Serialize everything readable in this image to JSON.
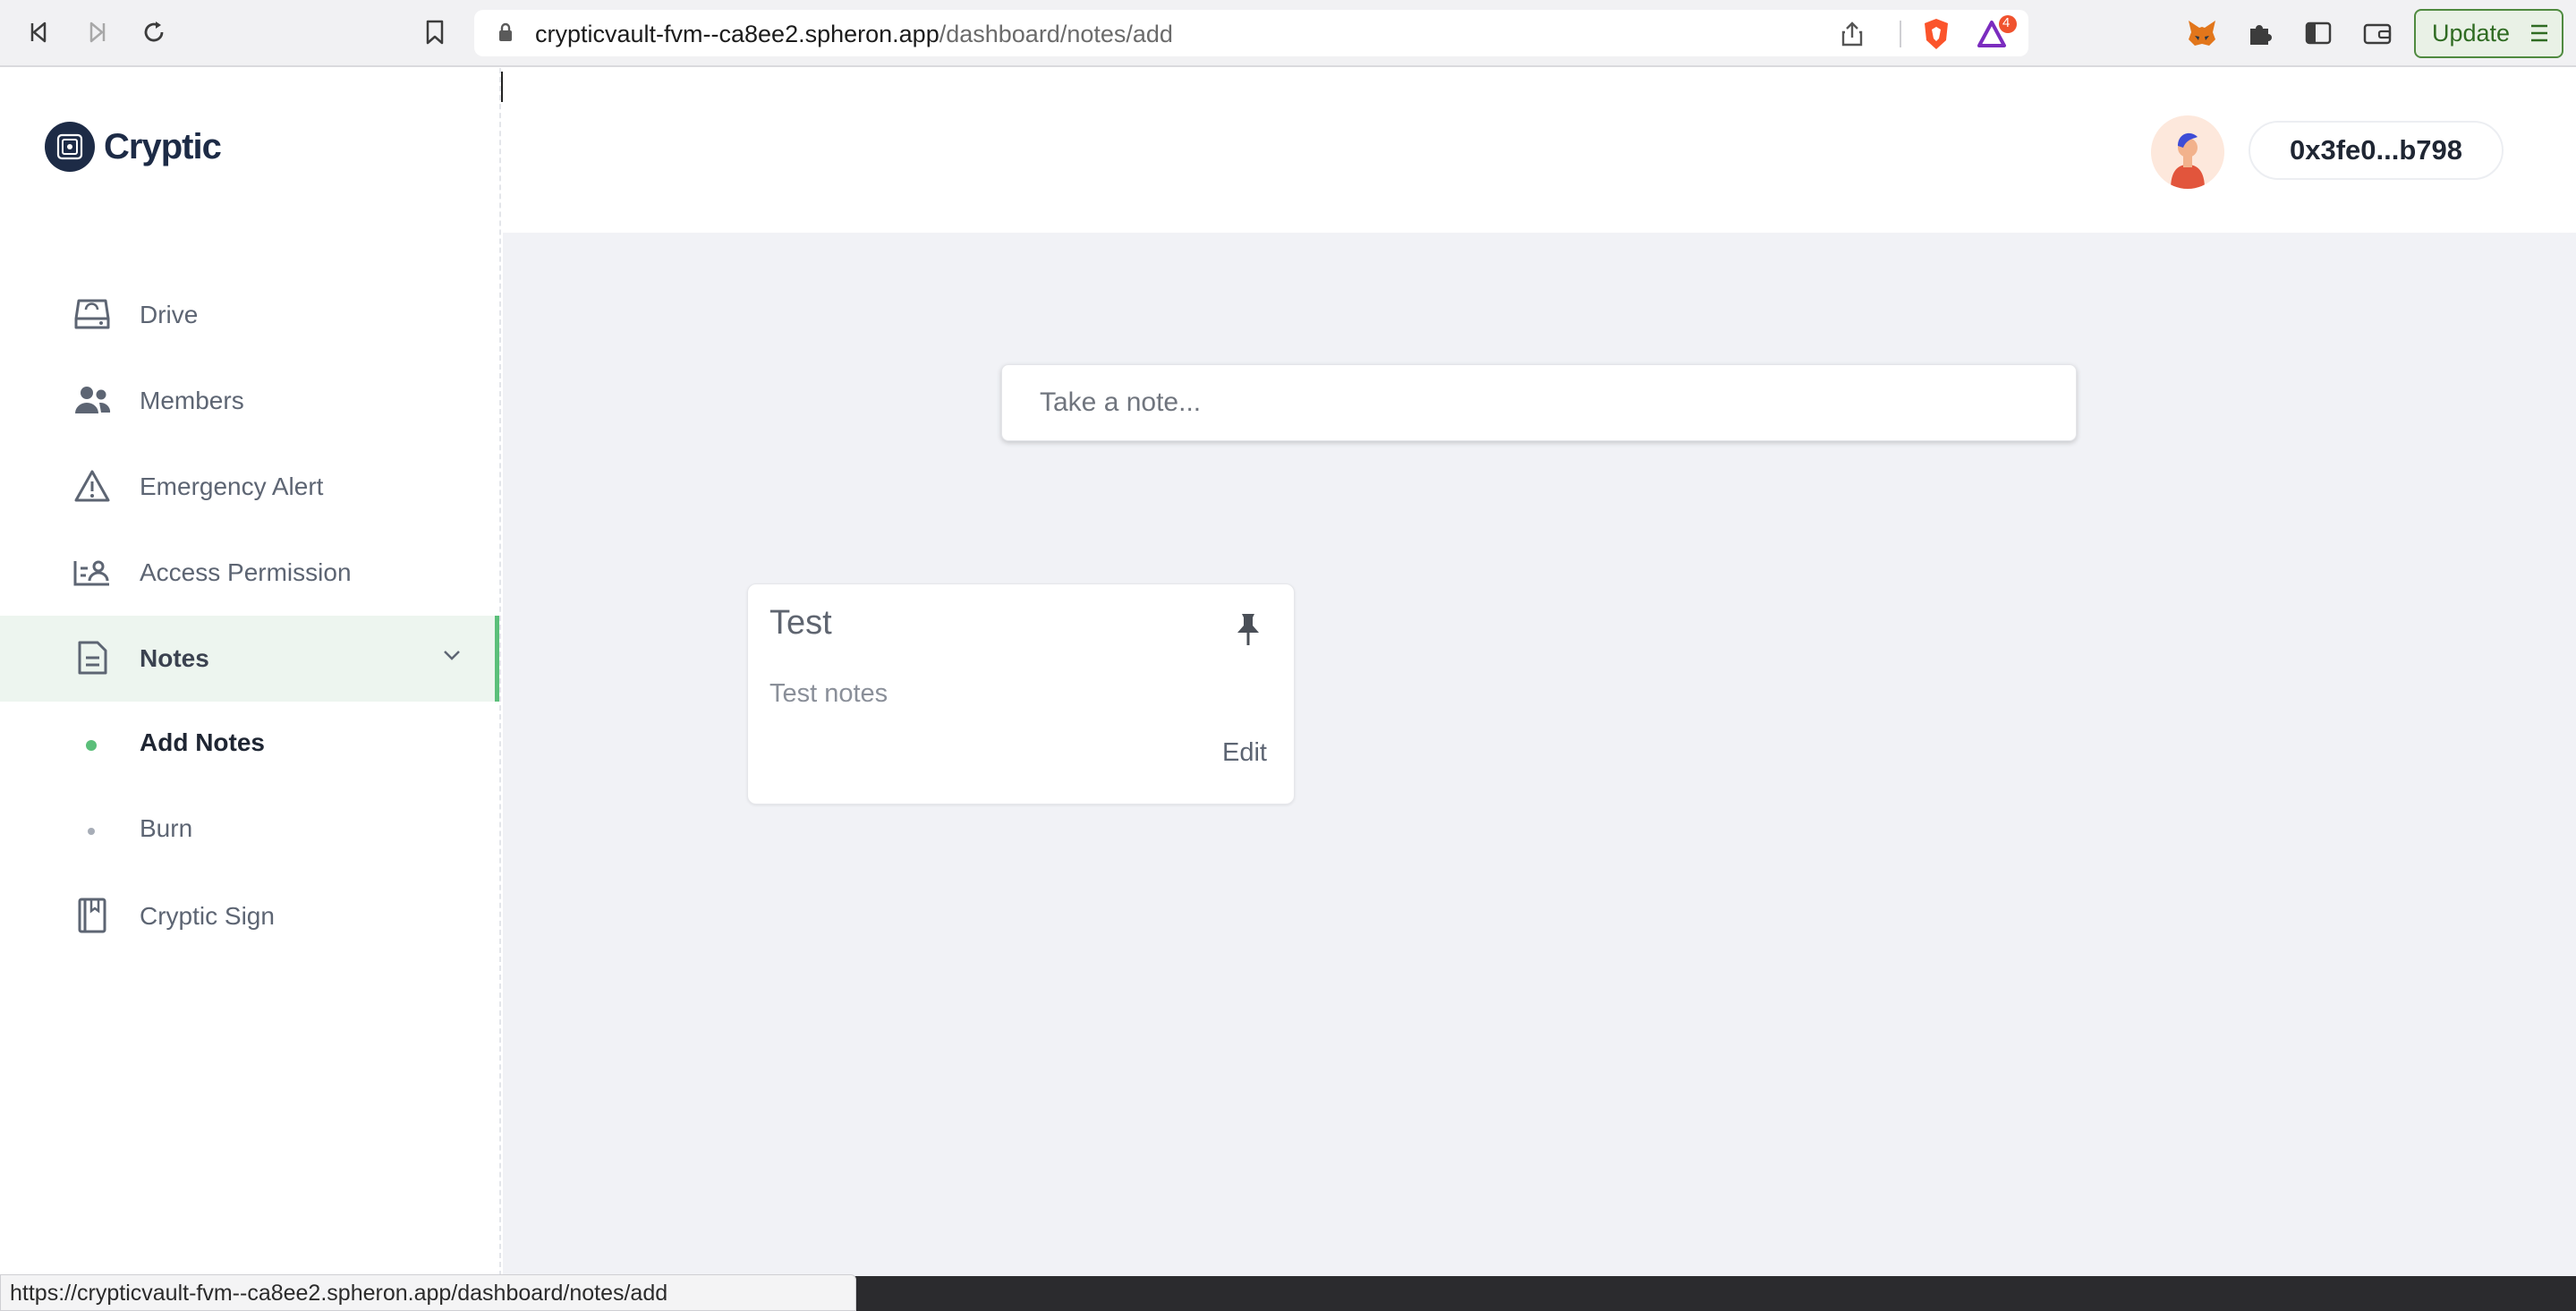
{
  "browser": {
    "url_host": "crypticvault-fvm--ca8ee2.spheron.app",
    "url_path": "/dashboard/notes/add",
    "update_label": "Update",
    "brave_badge": "4",
    "status_url": "https://crypticvault-fvm--ca8ee2.spheron.app/dashboard/notes/add"
  },
  "brand": {
    "name": "Cryptic"
  },
  "sidebar": {
    "items": [
      {
        "label": "Drive",
        "icon": "drive-icon"
      },
      {
        "label": "Members",
        "icon": "members-icon"
      },
      {
        "label": "Emergency Alert",
        "icon": "warning-icon"
      },
      {
        "label": "Access Permission",
        "icon": "access-permission-icon"
      },
      {
        "label": "Notes",
        "icon": "notes-icon"
      },
      {
        "label": "Cryptic Sign",
        "icon": "sign-icon"
      }
    ],
    "sub_items": [
      {
        "label": "Add Notes"
      },
      {
        "label": "Burn"
      }
    ]
  },
  "header": {
    "wallet_address": "0x3fe0...b798"
  },
  "main": {
    "note_placeholder": "Take a note...",
    "notes": [
      {
        "title": "Test",
        "body": "Test notes",
        "edit_label": "Edit"
      }
    ]
  },
  "colors": {
    "accent": "#5bbf7a",
    "brand": "#1d2b46",
    "background": "#f1f2f6"
  }
}
